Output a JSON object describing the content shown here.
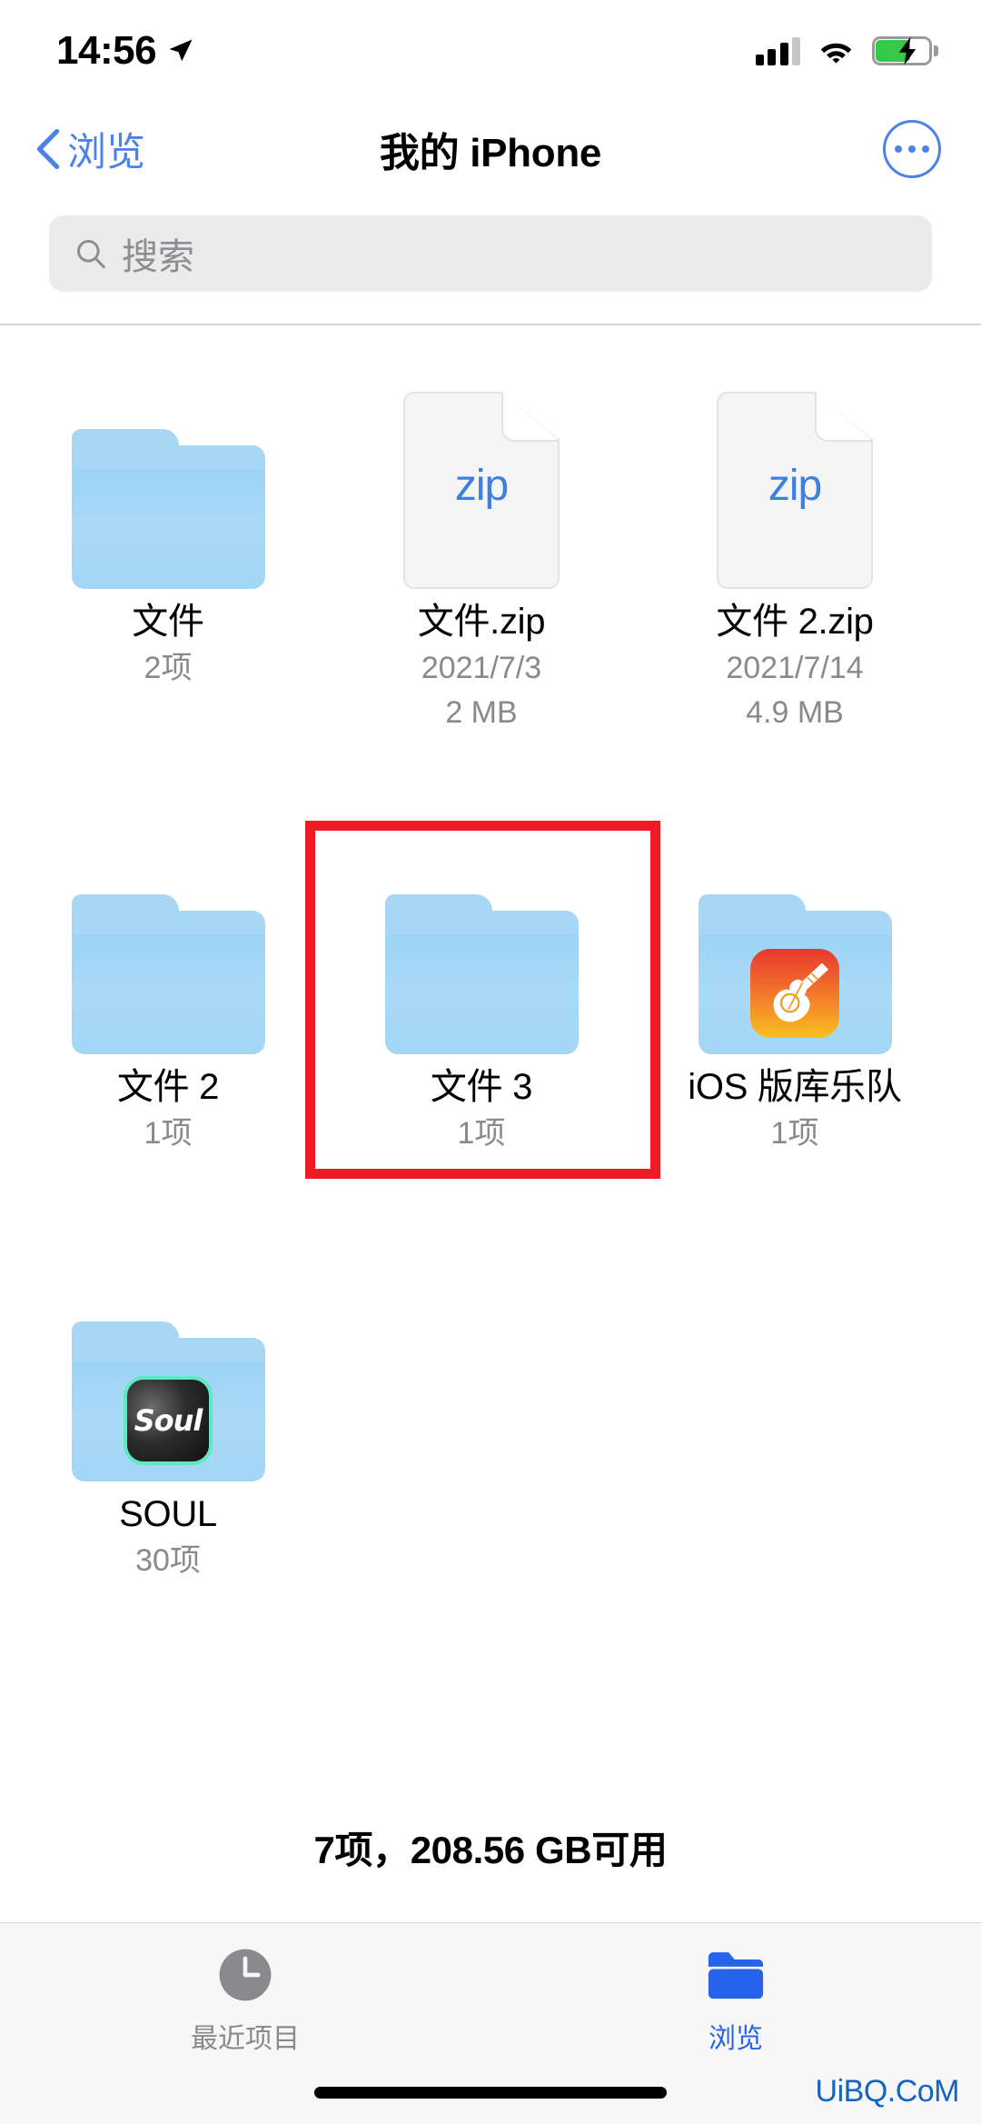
{
  "status_bar": {
    "time": "14:56",
    "location_icon": "location-arrow-icon",
    "signal_icon": "cellular-signal-icon",
    "signal_bars_filled": 3,
    "signal_bars_total": 4,
    "wifi_icon": "wifi-icon",
    "battery_icon": "battery-charging-icon",
    "battery_charging": true,
    "battery_color": "#37c84a"
  },
  "nav": {
    "back_label": "浏览",
    "back_icon": "chevron-left-icon",
    "title": "我的 iPhone",
    "more_icon": "ellipsis-circle-icon",
    "accent_color": "#4b83e8"
  },
  "search": {
    "placeholder": "搜索",
    "value": "",
    "icon": "search-icon"
  },
  "grid": {
    "rows": [
      {
        "items": [
          {
            "name": "文件",
            "sub1": "2项",
            "sub2": "",
            "icon": "folder-icon",
            "badge": "none",
            "highlighted": false
          },
          {
            "name": "文件.zip",
            "sub1": "2021/7/3",
            "sub2": "2 MB",
            "icon": "zip-document-icon",
            "ext": "zip",
            "badge": "none",
            "highlighted": false
          },
          {
            "name": "文件 2.zip",
            "sub1": "2021/7/14",
            "sub2": "4.9 MB",
            "icon": "zip-document-icon",
            "ext": "zip",
            "badge": "none",
            "highlighted": false
          }
        ]
      },
      {
        "items": [
          {
            "name": "文件 2",
            "sub1": "1项",
            "sub2": "",
            "icon": "folder-icon",
            "badge": "none",
            "highlighted": false
          },
          {
            "name": "文件 3",
            "sub1": "1项",
            "sub2": "",
            "icon": "folder-icon",
            "badge": "none",
            "highlighted": true
          },
          {
            "name": "iOS 版库乐队",
            "sub1": "1项",
            "sub2": "",
            "icon": "folder-icon",
            "badge": "garageband",
            "highlighted": false
          }
        ]
      },
      {
        "items": [
          {
            "name": "SOUL",
            "sub1": "30项",
            "sub2": "",
            "icon": "folder-icon",
            "badge": "soul",
            "badge_text": "Soul",
            "highlighted": false
          }
        ]
      }
    ]
  },
  "annotation": {
    "shape": "rectangle",
    "color": "#ed1c24",
    "target": "文件 3"
  },
  "summary": "7项，208.56 GB可用",
  "tab_bar": {
    "tabs": [
      {
        "label": "最近项目",
        "icon": "clock-icon",
        "active": false
      },
      {
        "label": "浏览",
        "icon": "folder-icon",
        "active": true
      }
    ],
    "active_color": "#2563eb",
    "inactive_color": "#8a8a8e"
  },
  "watermark": "UiBQ.CoM"
}
